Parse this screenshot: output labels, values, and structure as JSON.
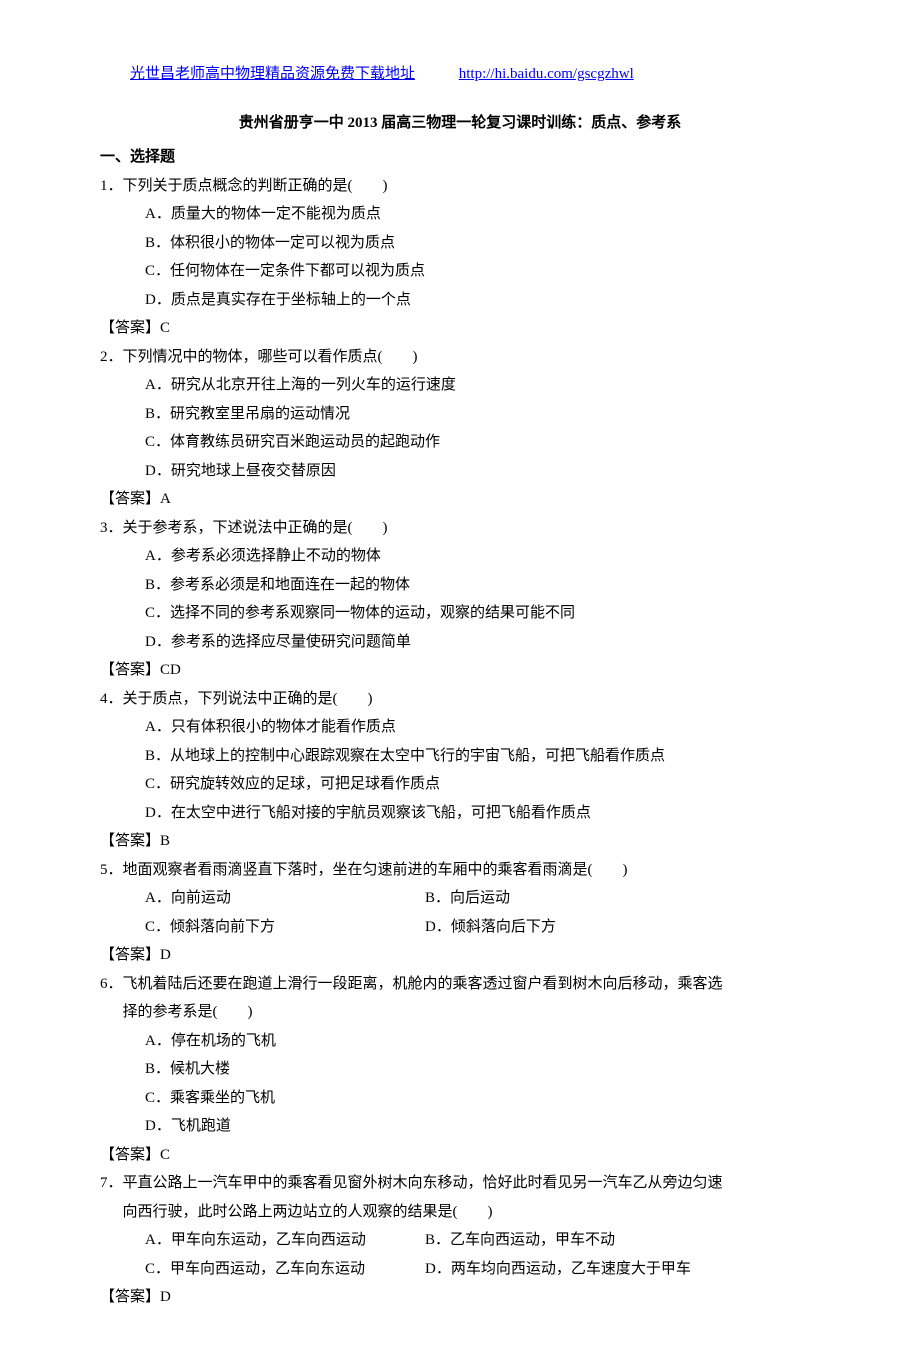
{
  "header": {
    "link_text": "光世昌老师高中物理精品资源免费下载地址",
    "url": "http://hi.baidu.com/gscgzhwl"
  },
  "title": "贵州省册亨一中 2013 届高三物理一轮复习课时训练：质点、参考系",
  "section_heading": "一、选择题",
  "questions": [
    {
      "stem": "1．下列关于质点概念的判断正确的是(　　)",
      "options": [
        "A．质量大的物体一定不能视为质点",
        "B．体积很小的物体一定可以视为质点",
        "C．任何物体在一定条件下都可以视为质点",
        "D．质点是真实存在于坐标轴上的一个点"
      ],
      "answer": "【答案】C"
    },
    {
      "stem": "2．下列情况中的物体，哪些可以看作质点(　　)",
      "options": [
        "A．研究从北京开往上海的一列火车的运行速度",
        "B．研究教室里吊扇的运动情况",
        "C．体育教练员研究百米跑运动员的起跑动作",
        "D．研究地球上昼夜交替原因"
      ],
      "answer": "【答案】A"
    },
    {
      "stem": "3．关于参考系，下述说法中正确的是(　　)",
      "options": [
        "A．参考系必须选择静止不动的物体",
        "B．参考系必须是和地面连在一起的物体",
        "C．选择不同的参考系观察同一物体的运动，观察的结果可能不同",
        "D．参考系的选择应尽量使研究问题简单"
      ],
      "answer": "【答案】CD"
    },
    {
      "stem": "4．关于质点，下列说法中正确的是(　　)",
      "options": [
        "A．只有体积很小的物体才能看作质点",
        "B．从地球上的控制中心跟踪观察在太空中飞行的宇宙飞船，可把飞船看作质点",
        "C．研究旋转效应的足球，可把足球看作质点",
        "D．在太空中进行飞船对接的宇航员观察该飞船，可把飞船看作质点"
      ],
      "answer": "【答案】B"
    },
    {
      "stem": "5．地面观察者看雨滴竖直下落时，坐在匀速前进的车厢中的乘客看雨滴是(　　)",
      "row_options": [
        {
          "left": "A．向前运动",
          "right": "B．向后运动"
        },
        {
          "left": "C．倾斜落向前下方",
          "right": "D．倾斜落向后下方"
        }
      ],
      "answer": "【答案】D"
    },
    {
      "stem": "6．飞机着陆后还要在跑道上滑行一段距离，机舱内的乘客透过窗户看到树木向后移动，乘客选",
      "stem_cont": "择的参考系是(　　)",
      "options": [
        "A．停在机场的飞机",
        "B．候机大楼",
        "C．乘客乘坐的飞机",
        "D．飞机跑道"
      ],
      "answer": "【答案】C"
    },
    {
      "stem": "7．平直公路上一汽车甲中的乘客看见窗外树木向东移动，恰好此时看见另一汽车乙从旁边匀速",
      "stem_cont": "向西行驶，此时公路上两边站立的人观察的结果是(　　)",
      "row_options": [
        {
          "left": "A．甲车向东运动，乙车向西运动",
          "right": "B．乙车向西运动，甲车不动"
        },
        {
          "left": "C．甲车向西运动，乙车向东运动",
          "right": "D．两车均向西运动，乙车速度大于甲车"
        }
      ],
      "answer": "【答案】D"
    }
  ]
}
